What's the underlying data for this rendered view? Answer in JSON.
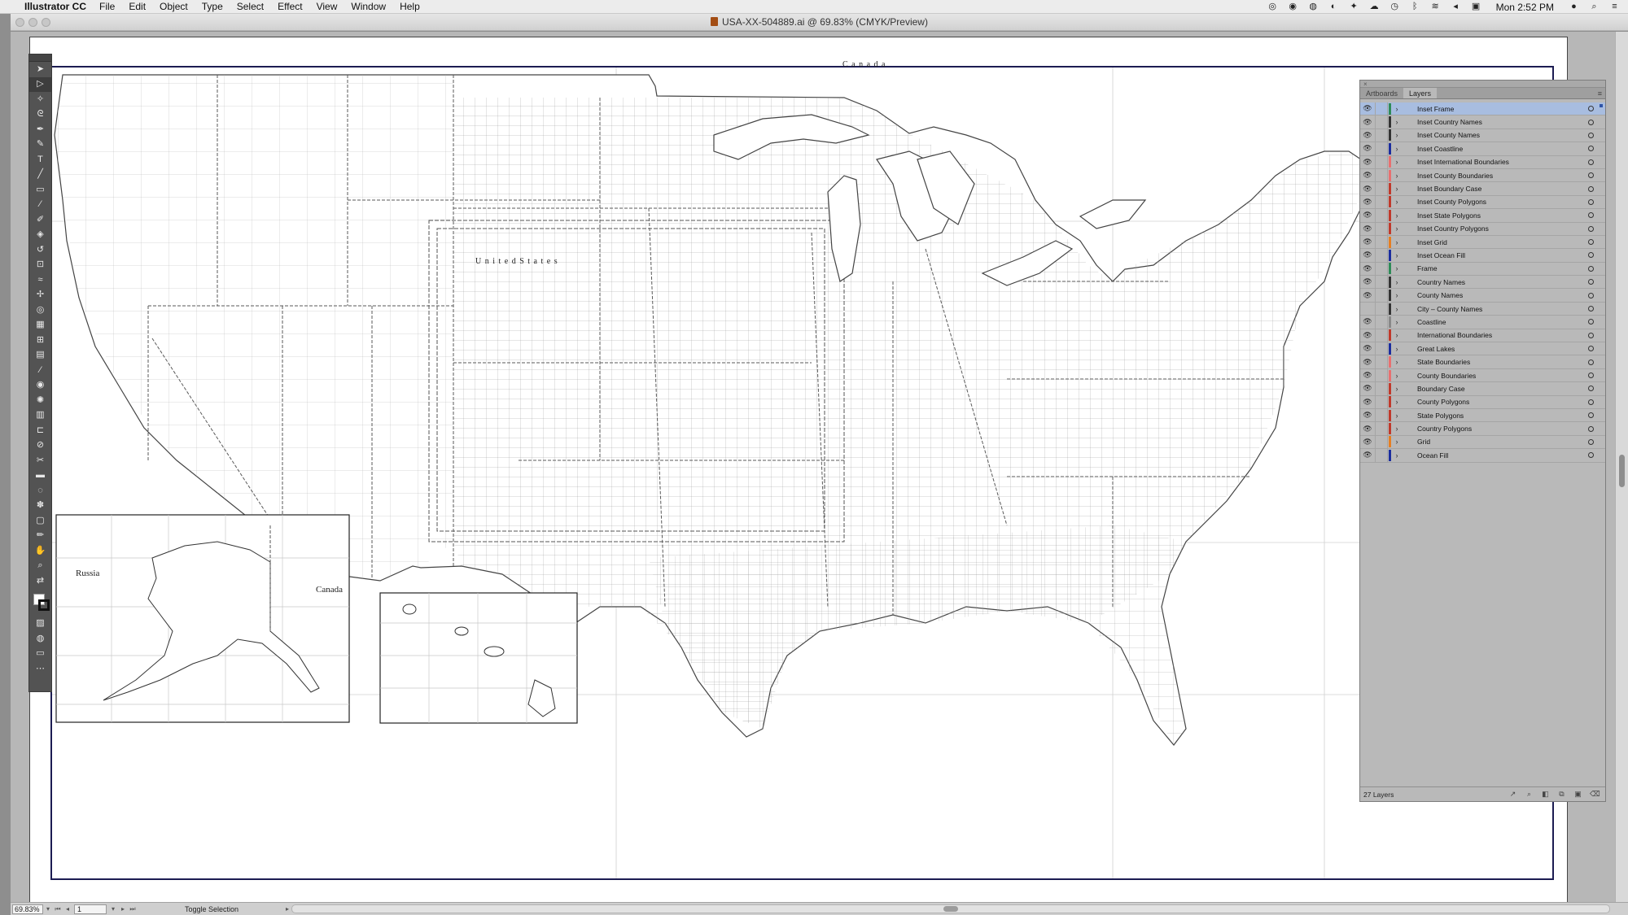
{
  "menubar": {
    "app_name": "Illustrator CC",
    "items": [
      "File",
      "Edit",
      "Object",
      "Type",
      "Select",
      "Effect",
      "View",
      "Window",
      "Help"
    ],
    "clock": "Mon 2:52 PM",
    "status_icons": [
      "creative-cloud-icon",
      "sync-icon",
      "pause-icon",
      "moon-icon",
      "dropbox-icon",
      "cloud-icon",
      "time-machine-icon",
      "bluetooth-icon",
      "wifi-icon",
      "volume-icon",
      "caption-icon",
      "user-icon",
      "spotlight-icon",
      "list-icon"
    ]
  },
  "window": {
    "title": "USA-XX-504889.ai @ 69.83% (CMYK/Preview)"
  },
  "map": {
    "labels": {
      "canada_main": "C a n a d a",
      "united_states": "U n i t e d   S t a t e s",
      "russia": "Russia",
      "canada_inset": "Canada"
    },
    "colors": {
      "frame": "#1c1c52",
      "boundary": "#555555",
      "grid": "#c8c8c8"
    }
  },
  "layers_panel": {
    "tabs": [
      "Artboards",
      "Layers"
    ],
    "active_tab": "Layers",
    "layers": [
      {
        "name": "Inset Frame",
        "color": "#2e8b57",
        "visible": true,
        "selected": true
      },
      {
        "name": "Inset Country Names",
        "color": "#333333",
        "visible": true,
        "selected": false
      },
      {
        "name": "Inset County Names",
        "color": "#333333",
        "visible": true,
        "selected": false
      },
      {
        "name": "Inset Coastline",
        "color": "#1b2d9e",
        "visible": true,
        "selected": false
      },
      {
        "name": "Inset International Boundaries",
        "color": "#e87070",
        "visible": true,
        "selected": false
      },
      {
        "name": "Inset County Boundaries",
        "color": "#e87070",
        "visible": true,
        "selected": false
      },
      {
        "name": "Inset Boundary Case",
        "color": "#c0392b",
        "visible": true,
        "selected": false
      },
      {
        "name": "Inset County Polygons",
        "color": "#c0392b",
        "visible": true,
        "selected": false
      },
      {
        "name": "Inset State Polygons",
        "color": "#c0392b",
        "visible": true,
        "selected": false
      },
      {
        "name": "Inset Country Polygons",
        "color": "#c0392b",
        "visible": true,
        "selected": false
      },
      {
        "name": "Inset Grid",
        "color": "#e67e22",
        "visible": true,
        "selected": false
      },
      {
        "name": "Inset Ocean Fill",
        "color": "#1b2d9e",
        "visible": true,
        "selected": false
      },
      {
        "name": "Frame",
        "color": "#2e8b57",
        "visible": true,
        "selected": false
      },
      {
        "name": "Country Names",
        "color": "#333333",
        "visible": true,
        "selected": false
      },
      {
        "name": "County Names",
        "color": "#333333",
        "visible": true,
        "selected": false
      },
      {
        "name": "City – County Names",
        "color": "#333333",
        "visible": false,
        "selected": false
      },
      {
        "name": "Coastline",
        "color": "#888888",
        "visible": true,
        "selected": false
      },
      {
        "name": "International Boundaries",
        "color": "#c0392b",
        "visible": true,
        "selected": false
      },
      {
        "name": "Great Lakes",
        "color": "#1b2d9e",
        "visible": true,
        "selected": false
      },
      {
        "name": "State Boundaries",
        "color": "#e87070",
        "visible": true,
        "selected": false
      },
      {
        "name": "County Boundaries",
        "color": "#e87070",
        "visible": true,
        "selected": false
      },
      {
        "name": "Boundary Case",
        "color": "#c0392b",
        "visible": true,
        "selected": false
      },
      {
        "name": "County Polygons",
        "color": "#c0392b",
        "visible": true,
        "selected": false
      },
      {
        "name": "State Polygons",
        "color": "#c0392b",
        "visible": true,
        "selected": false
      },
      {
        "name": "Country Polygons",
        "color": "#c0392b",
        "visible": true,
        "selected": false
      },
      {
        "name": "Grid",
        "color": "#e67e22",
        "visible": true,
        "selected": false
      },
      {
        "name": "Ocean Fill",
        "color": "#1b2d9e",
        "visible": true,
        "selected": false
      }
    ],
    "footer_count": "27 Layers"
  },
  "tools": [
    "selection-tool",
    "direct-selection-tool",
    "magic-wand-tool",
    "lasso-tool",
    "pen-tool",
    "curvature-tool",
    "type-tool",
    "line-tool",
    "rectangle-tool",
    "paintbrush-tool",
    "shaper-tool",
    "eraser-tool",
    "rotate-tool",
    "scale-tool",
    "width-tool",
    "free-transform-tool",
    "shape-builder-tool",
    "perspective-grid-tool",
    "mesh-tool",
    "gradient-tool",
    "eyedropper-tool",
    "blend-tool",
    "symbol-sprayer-tool",
    "column-graph-tool",
    "artboard-tool",
    "slice-tool",
    "knife-tool",
    "ruler-tool",
    "rotate-view-tool",
    "live-paint-tool",
    "print-tiling-tool",
    "pencil-tool",
    "hand-tool",
    "zoom-tool"
  ],
  "statusbar": {
    "zoom": "69.83%",
    "artboard_number": "1",
    "status_text": "Toggle Selection"
  }
}
